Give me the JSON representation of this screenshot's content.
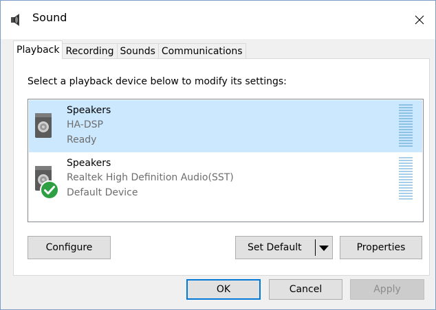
{
  "window": {
    "title": "Sound"
  },
  "tabs": [
    {
      "label": "Playback",
      "active": true
    },
    {
      "label": "Recording",
      "active": false
    },
    {
      "label": "Sounds",
      "active": false
    },
    {
      "label": "Communications",
      "active": false
    }
  ],
  "playback": {
    "instructions": "Select a playback device below to modify its settings:",
    "devices": [
      {
        "name": "Speakers",
        "description": "HA-DSP",
        "status": "Ready",
        "selected": true,
        "is_default": false,
        "icon": "speaker-icon"
      },
      {
        "name": "Speakers",
        "description": "Realtek High Definition Audio(SST)",
        "status": "Default Device",
        "selected": false,
        "is_default": true,
        "icon": "speaker-icon"
      }
    ]
  },
  "buttons": {
    "configure": "Configure",
    "set_default": "Set Default",
    "properties": "Properties",
    "ok": "OK",
    "cancel": "Cancel",
    "apply": "Apply"
  },
  "colors": {
    "selection": "#cce8ff",
    "default_check": "#2ea043",
    "focus_border": "#0078d7"
  }
}
